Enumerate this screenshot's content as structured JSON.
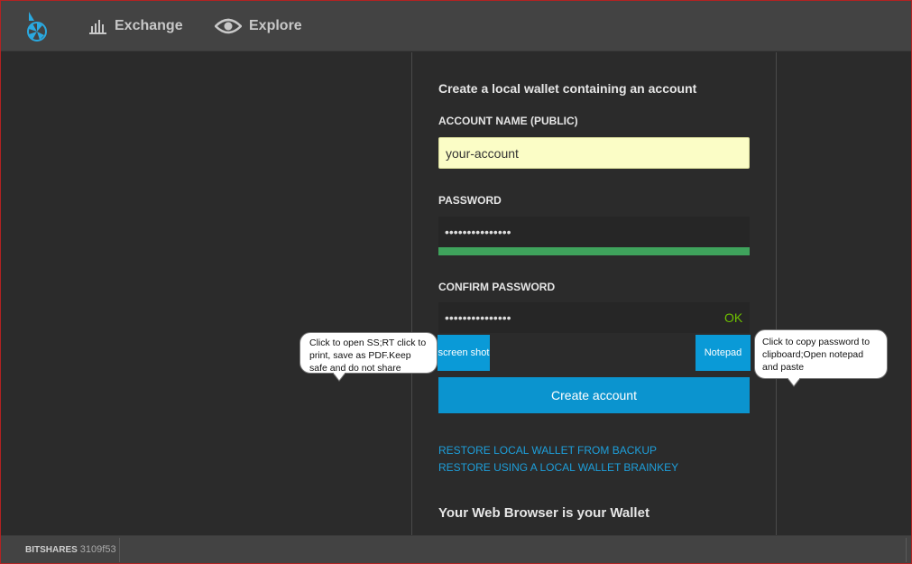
{
  "header": {
    "nav": [
      {
        "label": "Exchange",
        "icon": "bar-chart-icon"
      },
      {
        "label": "Explore",
        "icon": "eye-icon"
      }
    ]
  },
  "form": {
    "title": "Create a local wallet containing an account",
    "account_label": "ACCOUNT NAME (PUBLIC)",
    "account_value": "your-account",
    "password_label": "PASSWORD",
    "password_value": "•••••••••••••••",
    "password_strength": 1.0,
    "confirm_label": "CONFIRM PASSWORD",
    "confirm_value": "•••••••••••••••",
    "confirm_status": "OK",
    "screenshot_button": "screen shot",
    "notepad_button": "Notepad",
    "create_button": "Create account",
    "links": {
      "restore_backup": "RESTORE LOCAL WALLET FROM BACKUP",
      "restore_brainkey": "RESTORE USING A LOCAL WALLET BRAINKEY"
    },
    "section_heading": "Your Web Browser is your Wallet"
  },
  "callouts": {
    "left": "Click to open SS;RT click to print, save as PDF.Keep safe and do not share",
    "right": "Click to copy password to clipboard;Open notepad and paste"
  },
  "footer": {
    "brand": "BITSHARES",
    "version": "3109f53"
  },
  "colors": {
    "accent_blue": "#0b94cf",
    "strength_green": "#3fa35c",
    "ok_green": "#6ec000",
    "link_blue": "#1d9fdb"
  }
}
